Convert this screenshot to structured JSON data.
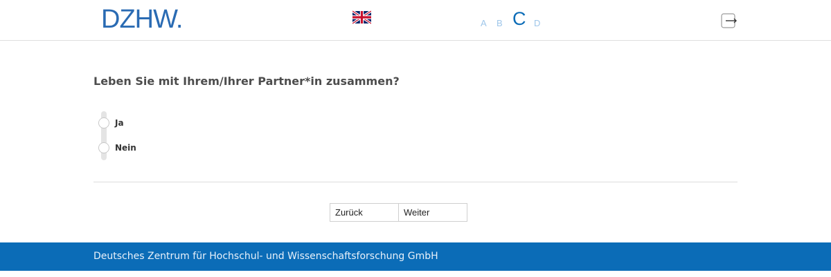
{
  "header": {
    "logo_text": "DZHW.",
    "language_flag_icon": "uk-flag-icon",
    "progress_steps": [
      "A",
      "B",
      "C",
      "D"
    ],
    "current_step": "C",
    "exit_icon": "exit-icon"
  },
  "question": {
    "text": "Leben Sie mit Ihrem/Ihrer Partner*in zusammen?",
    "options": [
      "Ja",
      "Nein"
    ]
  },
  "navigation": {
    "back_label": "Zurück",
    "next_label": "Weiter"
  },
  "footer": {
    "text": "Deutsches Zentrum für Hochschul- und Wissenschaftsforschung GmbH"
  },
  "colors": {
    "brand": "#0b6cb7",
    "inactive_step": "#9ec6ea"
  }
}
